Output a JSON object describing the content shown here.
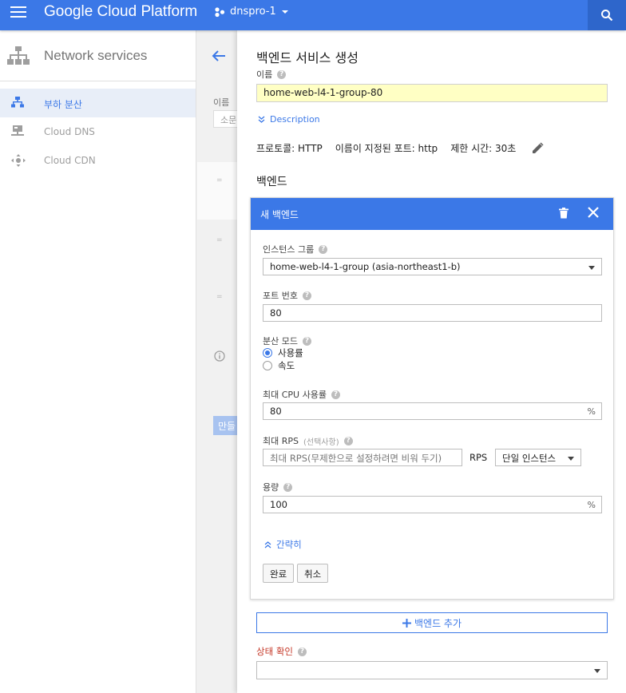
{
  "topbar": {
    "brand": "Google Cloud Platform",
    "project": "dnspro-1"
  },
  "sidebar": {
    "title": "Network services",
    "items": [
      {
        "label": "부하 분산",
        "active": true
      },
      {
        "label": "Cloud DNS",
        "active": false
      },
      {
        "label": "Cloud CDN",
        "active": false
      }
    ]
  },
  "middle": {
    "name_label": "이름",
    "filter_placeholder": "소문",
    "create_button": "만들"
  },
  "panel": {
    "title": "백엔드 서비스 생성",
    "name_label": "이름",
    "name_value": "home-web-l4-1-group-80",
    "description_link": "Description",
    "protocol": "프로토콜: HTTP",
    "named_port": "이름이 지정된 포트: http",
    "timeout": "제한 시간: 30초",
    "backend_section": "백엔드",
    "add_backend": "백엔드 추가",
    "health_check_label": "상태 확인"
  },
  "card": {
    "title": "새 백엔드",
    "instance_group_label": "인스턴스 그룹",
    "instance_group_value": "home-web-l4-1-group (asia-northeast1-b)",
    "port_label": "포트 번호",
    "port_value": "80",
    "balancing_mode_label": "분산 모드",
    "mode_utilization": "사용률",
    "mode_rate": "속도",
    "max_cpu_label": "최대 CPU 사용률",
    "max_cpu_value": "80",
    "percent": "%",
    "max_rps_label": "최대 RPS",
    "max_rps_optional": "(선택사항)",
    "max_rps_placeholder": "최대 RPS(무제한으로 설정하려면 비워 두기)",
    "rps_unit": "RPS",
    "rps_scope": "단일 인스턴스",
    "capacity_label": "용량",
    "capacity_value": "100",
    "less_link": "간략히",
    "done_button": "완료",
    "cancel_button": "취소"
  },
  "colors": {
    "primary": "#3b78e7",
    "error": "#c53929",
    "highlight_input": "#ffffc4"
  }
}
